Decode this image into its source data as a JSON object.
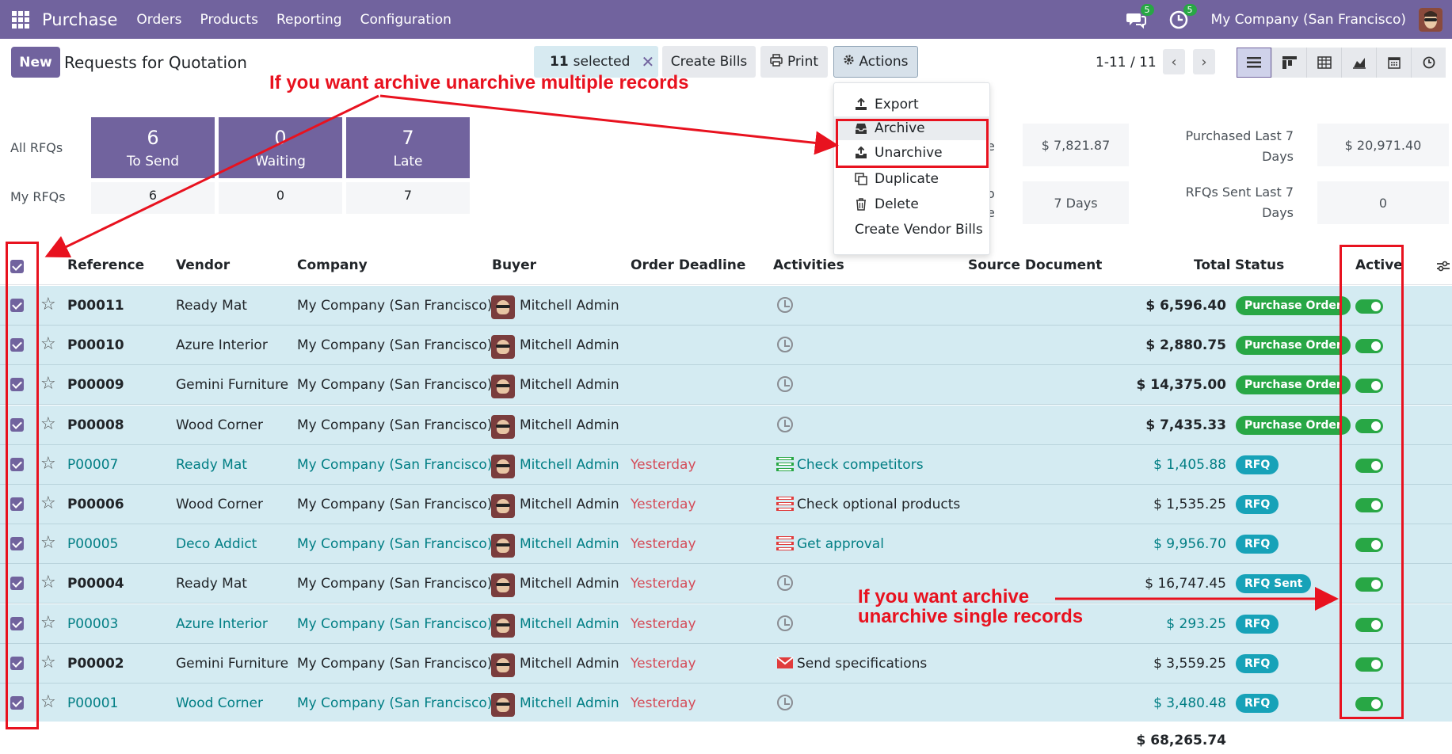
{
  "navbar": {
    "app_name": "Purchase",
    "menus": [
      "Orders",
      "Products",
      "Reporting",
      "Configuration"
    ],
    "chat_badge": "5",
    "activity_badge": "5",
    "company": "My Company (San Francisco)"
  },
  "control": {
    "new_label": "New",
    "title": "Requests for Quotation",
    "selected_count": "11",
    "selected_text": "selected",
    "create_bills_label": "Create Bills",
    "print_label": "Print",
    "actions_label": "Actions",
    "pager": "1-11 / 11"
  },
  "dashboard": {
    "all_label": "All RFQs",
    "my_label": "My RFQs",
    "tiles": [
      {
        "num": "6",
        "label": "To Send",
        "mine": "6"
      },
      {
        "num": "0",
        "label": "Waiting",
        "mine": "0"
      },
      {
        "num": "7",
        "label": "Late",
        "mine": "7"
      }
    ],
    "stats": {
      "partial_1": "e",
      "partial_2a": "o",
      "partial_2b": "e",
      "avg_value": "$ 7,821.87",
      "lead_time": "7 Days",
      "purchased_label_1": "Purchased Last 7",
      "purchased_label_2": "Days",
      "purchased_value": "$ 20,971.40",
      "sent_label_1": "RFQs Sent Last 7",
      "sent_label_2": "Days",
      "sent_value": "0"
    }
  },
  "actions_menu": [
    "Export",
    "Archive",
    "Unarchive",
    "Duplicate",
    "Delete",
    "Create Vendor Bills"
  ],
  "columns": [
    "Reference",
    "Vendor",
    "Company",
    "Buyer",
    "Order Deadline",
    "Activities",
    "Source Document",
    "Total",
    "Status",
    "Active"
  ],
  "rows": [
    {
      "ref": "P00011",
      "vendor": "Ready Mat",
      "company": "My Company (San Francisco)",
      "buyer": "Mitchell Admin",
      "deadline": "",
      "activity": "",
      "activity_icon": "clock-icon",
      "total": "$ 6,596.40",
      "status": "Purchase Order"
    },
    {
      "ref": "P00010",
      "vendor": "Azure Interior",
      "company": "My Company (San Francisco)",
      "buyer": "Mitchell Admin",
      "deadline": "",
      "activity": "",
      "activity_icon": "clock-icon",
      "total": "$ 2,880.75",
      "status": "Purchase Order"
    },
    {
      "ref": "P00009",
      "vendor": "Gemini Furniture",
      "company": "My Company (San Francisco)",
      "buyer": "Mitchell Admin",
      "deadline": "",
      "activity": "",
      "activity_icon": "clock-icon",
      "total": "$ 14,375.00",
      "status": "Purchase Order"
    },
    {
      "ref": "P00008",
      "vendor": "Wood Corner",
      "company": "My Company (San Francisco)",
      "buyer": "Mitchell Admin",
      "deadline": "",
      "activity": "",
      "activity_icon": "clock-icon",
      "total": "$ 7,435.33",
      "status": "Purchase Order"
    },
    {
      "ref": "P00007",
      "vendor": "Ready Mat",
      "company": "My Company (San Francisco)",
      "buyer": "Mitchell Admin",
      "deadline": "Yesterday",
      "activity": "Check competitors",
      "activity_icon": "list-green-icon",
      "total": "$ 1,405.88",
      "status": "RFQ"
    },
    {
      "ref": "P00006",
      "vendor": "Wood Corner",
      "company": "My Company (San Francisco)",
      "buyer": "Mitchell Admin",
      "deadline": "Yesterday",
      "activity": "Check optional products",
      "activity_icon": "list-red-icon",
      "total": "$ 1,535.25",
      "status": "RFQ"
    },
    {
      "ref": "P00005",
      "vendor": "Deco Addict",
      "company": "My Company (San Francisco)",
      "buyer": "Mitchell Admin",
      "deadline": "Yesterday",
      "activity": "Get approval",
      "activity_icon": "list-red-icon",
      "total": "$ 9,956.70",
      "status": "RFQ"
    },
    {
      "ref": "P00004",
      "vendor": "Ready Mat",
      "company": "My Company (San Francisco)",
      "buyer": "Mitchell Admin",
      "deadline": "Yesterday",
      "activity": "",
      "activity_icon": "clock-icon",
      "total": "$ 16,747.45",
      "status": "RFQ Sent"
    },
    {
      "ref": "P00003",
      "vendor": "Azure Interior",
      "company": "My Company (San Francisco)",
      "buyer": "Mitchell Admin",
      "deadline": "Yesterday",
      "activity": "",
      "activity_icon": "clock-icon",
      "total": "$ 293.25",
      "status": "RFQ"
    },
    {
      "ref": "P00002",
      "vendor": "Gemini Furniture",
      "company": "My Company (San Francisco)",
      "buyer": "Mitchell Admin",
      "deadline": "Yesterday",
      "activity": "Send specifications",
      "activity_icon": "envelope-red-icon",
      "total": "$ 3,559.25",
      "status": "RFQ"
    },
    {
      "ref": "P00001",
      "vendor": "Wood Corner",
      "company": "My Company (San Francisco)",
      "buyer": "Mitchell Admin",
      "deadline": "Yesterday",
      "activity": "",
      "activity_icon": "clock-icon",
      "total": "$ 3,480.48",
      "status": "RFQ"
    }
  ],
  "grand_total": "$ 68,265.74",
  "annotations": {
    "multi": "If you want archive unarchive multiple records",
    "single_1": "If you want archive",
    "single_2": "unarchive single records"
  },
  "colors": {
    "brand": "#71639e",
    "po_badge": "#28a745",
    "rfq_badge": "#17a2b8",
    "annotation": "#e8121f",
    "row_selected": "#d4ebf2"
  }
}
